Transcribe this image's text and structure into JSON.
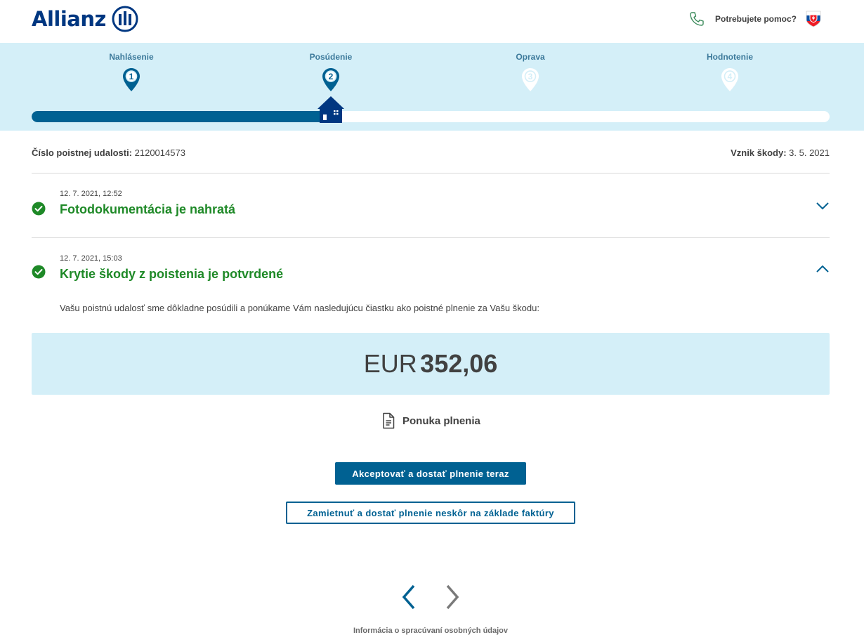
{
  "header": {
    "logo_text": "Allianz",
    "logo_icon": "allianz-eagle-icon",
    "help_icon": "phone-icon",
    "help_label": "Potrebujete pomoc?",
    "flag_icon": "slovak-flag-icon"
  },
  "steps": [
    {
      "label": "Nahlásenie",
      "number": "1",
      "state": "done"
    },
    {
      "label": "Posúdenie",
      "number": "2",
      "state": "current"
    },
    {
      "label": "Oprava",
      "number": "3",
      "state": "todo"
    },
    {
      "label": "Hodnotenie",
      "number": "4",
      "state": "todo"
    }
  ],
  "progress_fraction": 0.37,
  "claim": {
    "number_label": "Číslo poistnej udalosti:",
    "number_value": "2120014573",
    "date_label": "Vznik škody:",
    "date_value": "3. 5. 2021"
  },
  "events": [
    {
      "date": "12. 7. 2021, 12:52",
      "title": "Fotodokumentácia je nahratá",
      "expanded": false
    },
    {
      "date": "12. 7. 2021, 15:03",
      "title": "Krytie škody z poistenia je potvrdené",
      "expanded": true
    }
  ],
  "description": "Vašu poistnú udalosť sme dôkladne posúdili a ponúkame Vám nasledujúcu čiastku ako poistné plnenie za Vašu škodu:",
  "amount": {
    "currency": "EUR",
    "value": "352,06"
  },
  "offer": {
    "icon": "document-icon",
    "label": "Ponuka plnenia"
  },
  "buttons": {
    "accept_label": "Akceptovať a dostať plnenie teraz",
    "reject_label": "Zamietnuť a dostať plnenie neskôr na základe faktúry"
  },
  "nav": {
    "prev_icon": "chevron-left-icon",
    "next_icon": "chevron-right-icon"
  },
  "footer": {
    "privacy_label": "Informácia o spracúvaní osobných údajov"
  },
  "colors": {
    "brand": "#003781",
    "primary": "#006192",
    "band": "#d4eff8",
    "success": "#1e8927",
    "text": "#414141"
  }
}
